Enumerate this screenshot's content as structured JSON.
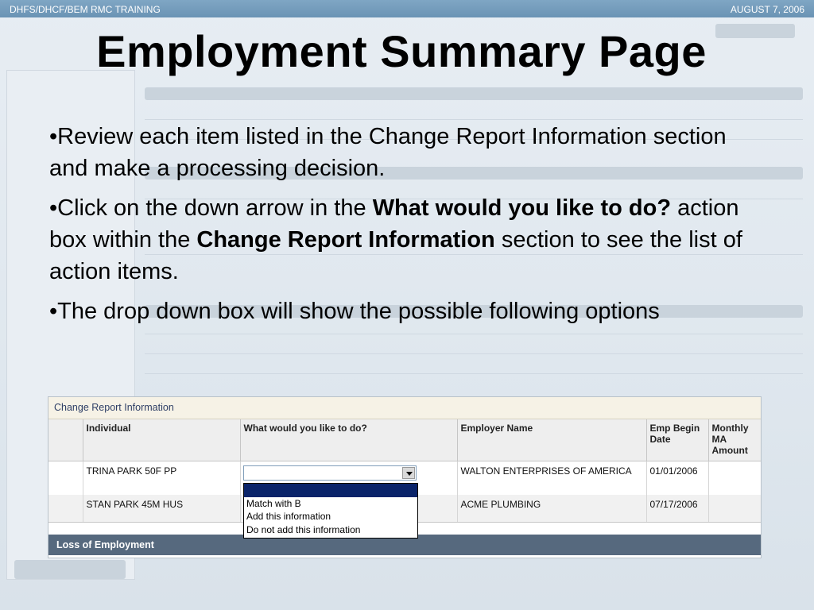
{
  "header": {
    "left_text": "DHFS/DHCF/BEM  RMC TRAINING",
    "right_text": "AUGUST 7, 2006"
  },
  "slide": {
    "title": "Employment Summary Page",
    "bullet1": "•Review each item listed in the Change Report Information section and make a processing decision.",
    "bullet2": {
      "p1": "•Click on the down arrow in the ",
      "b1": "What would you like to do?",
      "p2": " action box within the ",
      "b2": "Change Report Information",
      "p3": " section to see the list of action items."
    },
    "bullet3": "•The drop down box will show the possible following options"
  },
  "screenshot": {
    "section_title": "Change Report Information",
    "columns": [
      "",
      "Individual",
      "What would you like to do?",
      "Employer Name",
      "Emp Begin Date",
      "Monthly MA Amount"
    ],
    "rows": [
      {
        "individual": "TRINA PARK 50F PP",
        "employer": "WALTON ENTERPRISES OF AMERICA",
        "begin_date": "01/01/2006",
        "amount": ""
      },
      {
        "individual": "STAN PARK 45M HUS",
        "employer": "ACME PLUMBING",
        "begin_date": "07/17/2006",
        "amount": ""
      }
    ],
    "dropdown": {
      "selected_value": "",
      "options": [
        "",
        "Match with B",
        "Add this information",
        "Do not add this information"
      ]
    },
    "next_section_title": "Loss of Employment"
  }
}
